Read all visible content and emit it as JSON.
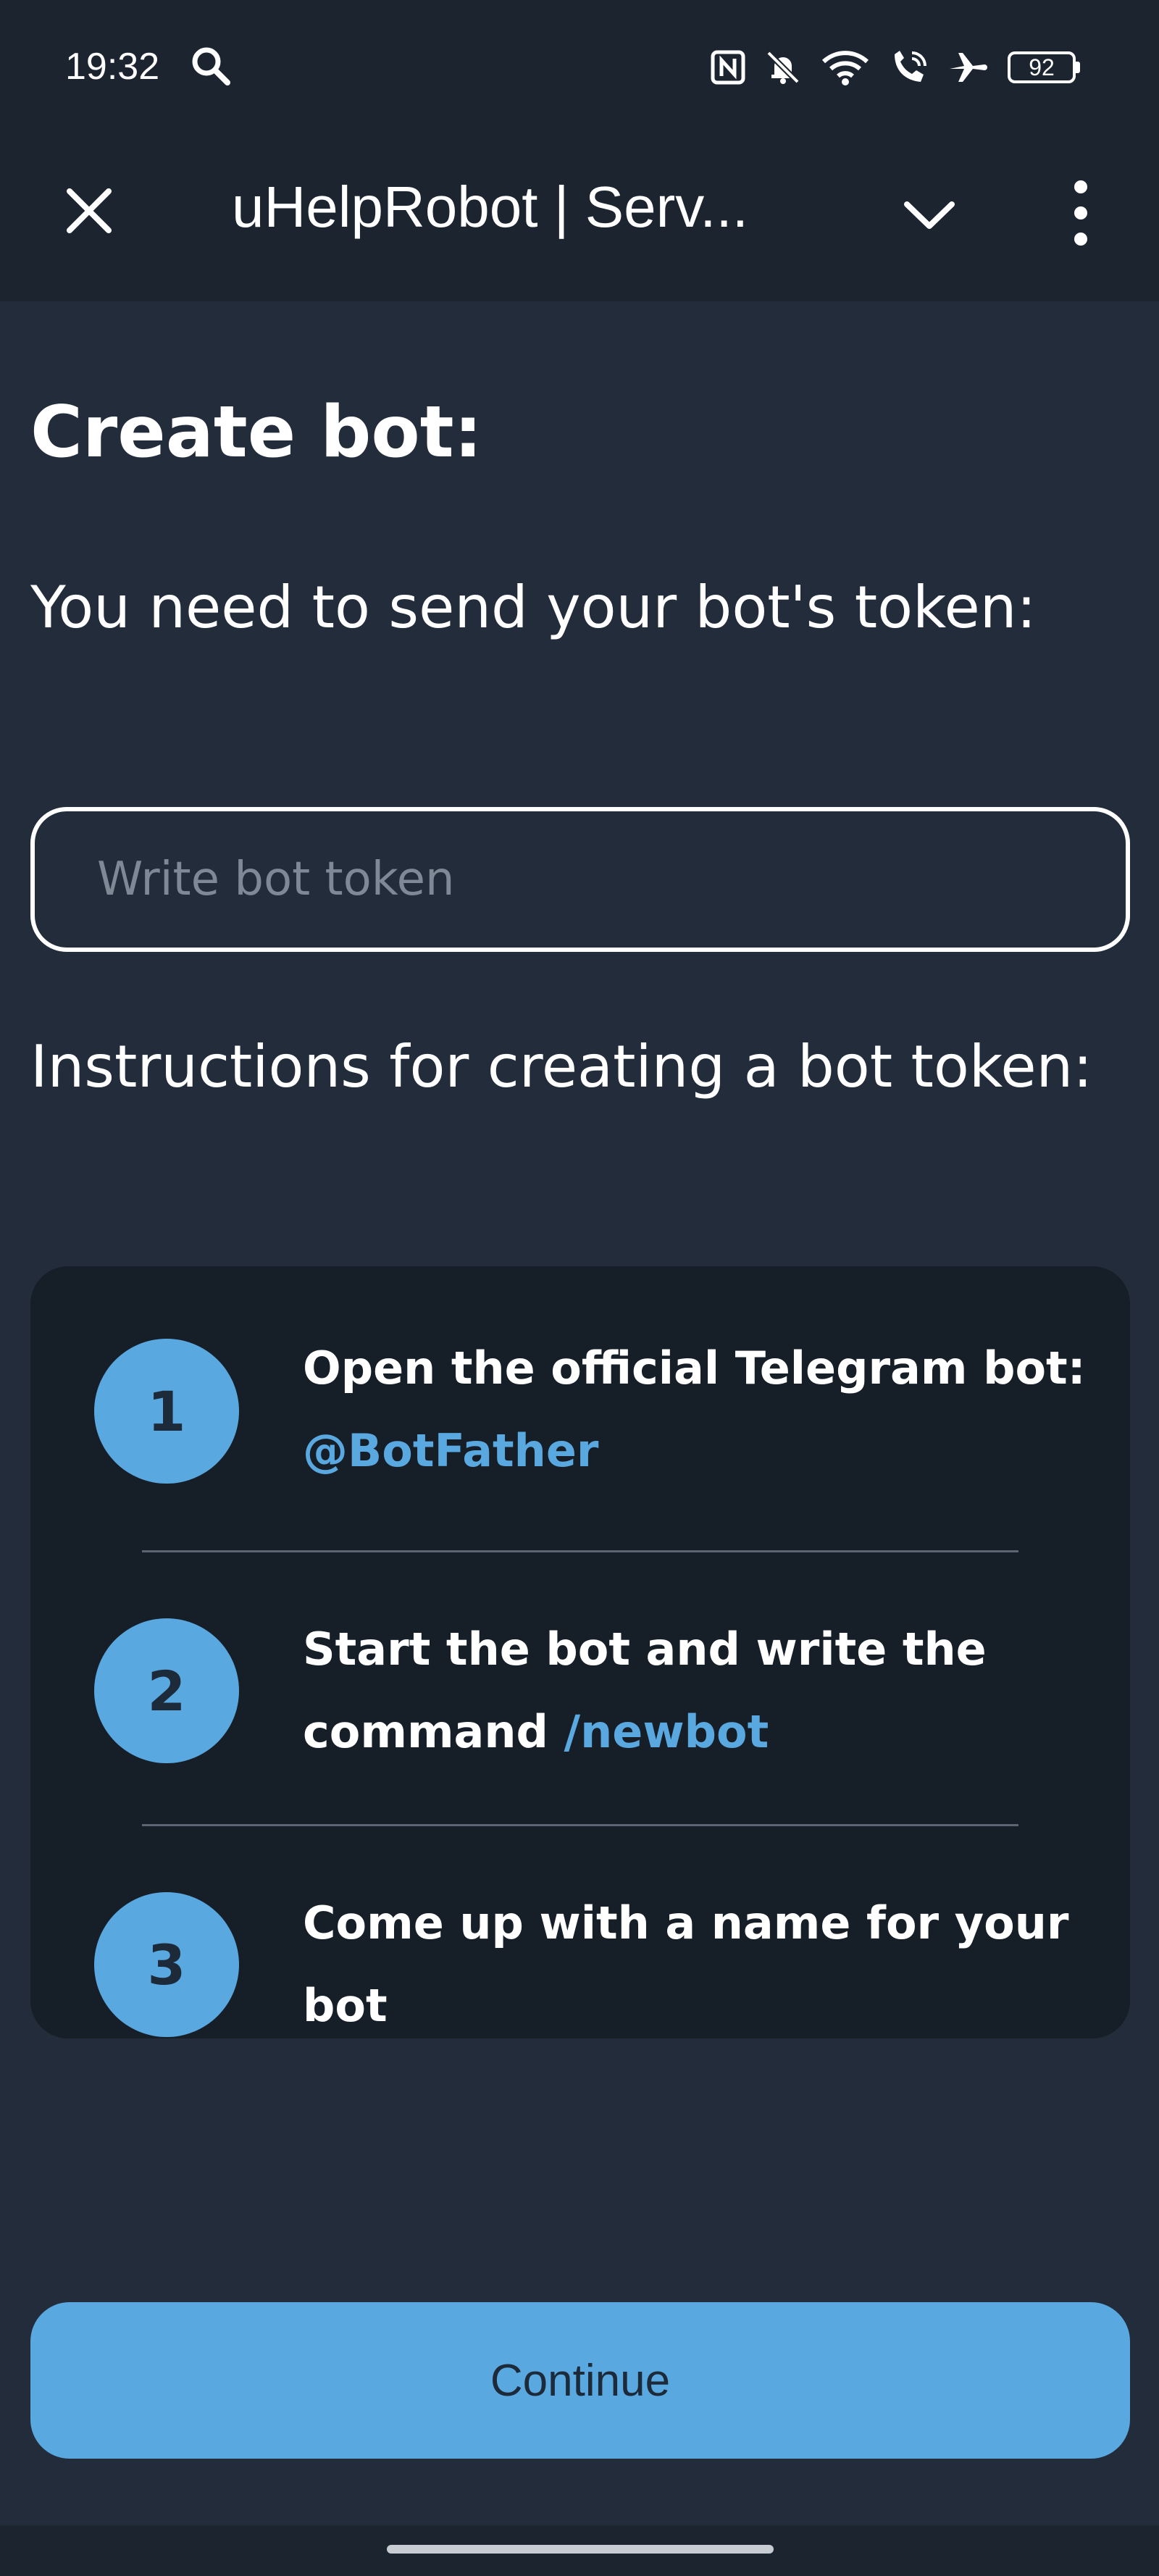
{
  "status_bar": {
    "time": "19:32",
    "battery": "92",
    "icons": [
      "search-icon",
      "nfc-icon",
      "bell-off-icon",
      "wifi-icon",
      "wifi-call-icon",
      "airplane-icon",
      "battery-icon"
    ]
  },
  "header": {
    "title": "uHelpRobot | Serv..."
  },
  "main": {
    "title": "Create bot:",
    "token_prompt": "You need to send your bot's token:",
    "token_placeholder": "Write bot token",
    "token_value": "",
    "instructions_title": "Instructions for creating a bot token:"
  },
  "steps": [
    {
      "number": "1",
      "text": "Open the official Telegram bot: ",
      "highlight": "@BotFather"
    },
    {
      "number": "2",
      "text": "Start the bot and write the command ",
      "highlight": "/newbot"
    },
    {
      "number": "3",
      "text": "Come up with a name for your bot",
      "highlight": ""
    }
  ],
  "footer": {
    "continue_label": "Continue"
  },
  "colors": {
    "background": "#222c3a",
    "bar": "#1c2430",
    "card": "#161e28",
    "accent": "#5aa8e0"
  }
}
